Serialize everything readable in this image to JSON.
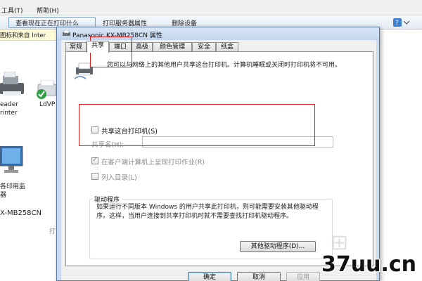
{
  "background": {
    "menu": {
      "tools": "工具(T)",
      "help": "帮助(H)"
    },
    "toolbar": {
      "view_jobs": "查看现在正在打印什么",
      "server_props": "打印服务器属性",
      "remove_device": "删除设备"
    },
    "infobar": "图标和来自 Inter",
    "devices": [
      {
        "line1": "eader",
        "line2": "rinter"
      },
      {
        "line1": "LdVP",
        "line2": ""
      }
    ],
    "device_caption_1": "各印用监",
    "device_caption_2": "器",
    "model_label": "X-MB258CN",
    "partial_char": "打"
  },
  "dialog": {
    "title": "Panasonic KX-MB258CN 属性",
    "tabs": [
      "常规",
      "共享",
      "端口",
      "高级",
      "颜色管理",
      "安全",
      "纸盒"
    ],
    "active_tab": "共享",
    "info_text": "您可以与网络上的其他用户共享这台打印机。计算机睡眠或关闭时打印机将不可用。",
    "share_checkbox_label": "共享这台打印机(S)",
    "share_name_label": "共享名(H):",
    "share_name_value": "",
    "render_jobs_label": "在客户端计算机上呈现打印作业(R)",
    "list_directory_label": "列入目录(L)",
    "drivers_group_title": "驱动程序",
    "drivers_text": "如果运行不同版本 Windows 的用户共享此打印机，则可能需要安装其他驱动程序。这样，当用户连接到共享打印机时就不需要查找打印机驱动程序。",
    "other_drivers_button": "其他驱动程序(D)...",
    "ok_button": "确定",
    "cancel_button": "取消",
    "apply_button": "应用"
  },
  "watermark": "37uu.cn",
  "colors": {
    "highlight_box": "#e02020",
    "title_bar": "#c2d5ee"
  }
}
